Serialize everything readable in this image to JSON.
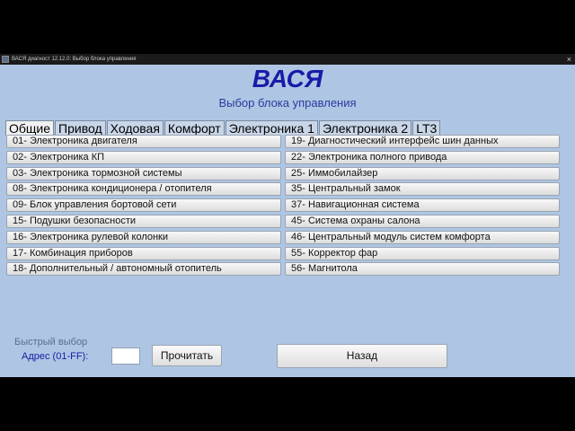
{
  "window": {
    "title": "ВАСЯ диагност 12.12.0: Выбор блока управления",
    "close_glyph": "×"
  },
  "header": {
    "title": "ВАСЯ",
    "subtitle": "Выбор блока управления"
  },
  "tabs": [
    {
      "label": "Общие"
    },
    {
      "label": "Привод"
    },
    {
      "label": "Ходовая"
    },
    {
      "label": "Комфорт"
    },
    {
      "label": "Электроника 1"
    },
    {
      "label": "Электроника 2"
    },
    {
      "label": "LT3"
    }
  ],
  "modules_left": [
    "01- Электроника двигателя",
    "02- Электроника КП",
    "03- Электроника тормозной системы",
    "08- Электроника кондиционера / отопителя",
    "09- Блок управления бортовой сети",
    "15- Подушки безопасности",
    "16- Электроника рулевой колонки",
    "17- Комбинация приборов",
    "18- Дополнительный / автономный отопитель"
  ],
  "modules_right": [
    "19- Диагностический интерфейс шин данных",
    "22- Электроника полного привода",
    "25- Иммобилайзер",
    "35- Центральный замок",
    "37- Навигационная система",
    "45- Система охраны салона",
    "46- Центральный модуль систем комфорта",
    "55- Корректор фар",
    "56- Магнитола"
  ],
  "quick_select": {
    "title": "Быстрый выбор",
    "address_label": "Адрес (01-FF):",
    "address_value": "",
    "read_label": "Прочитать"
  },
  "back_label": "Назад"
}
